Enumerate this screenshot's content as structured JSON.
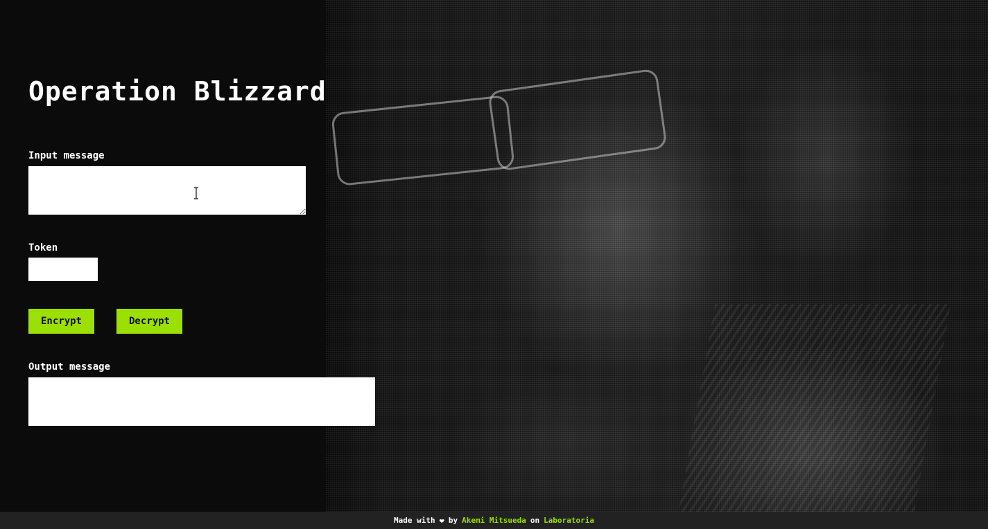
{
  "page": {
    "title": "Operation Blizzard"
  },
  "form": {
    "input_label": "Input message",
    "input_value": "",
    "token_label": "Token",
    "token_value": "",
    "encrypt_label": "Encrypt",
    "decrypt_label": "Decrypt",
    "output_label": "Output message",
    "output_value": ""
  },
  "footer": {
    "made_with": "Made with",
    "heart_icon": "heart-icon",
    "by": "by",
    "author": "Akemi Mitsueda",
    "on": "on",
    "org": "Laboratoria"
  },
  "colors": {
    "accent": "#9be002",
    "background": "#0b0b0b",
    "footer_bg": "#222222"
  }
}
